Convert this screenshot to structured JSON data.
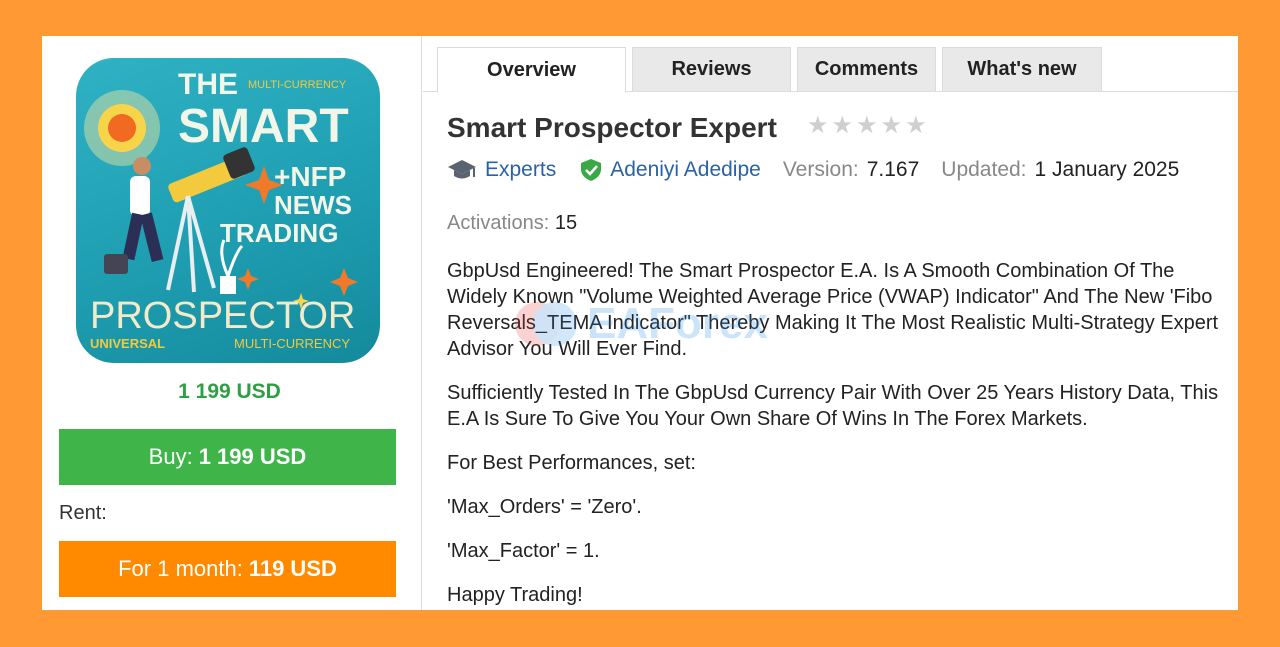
{
  "product": {
    "image_text": {
      "line1": "THE",
      "line1b": "MULTI-CURRENCY",
      "line2": "SMART",
      "line3": "+NFP",
      "line4": "NEWS",
      "line5": "TRADING",
      "line6": "PROSPECTOR",
      "line7a": "UNIVERSAL",
      "line7b": "MULTI-CURRENCY"
    },
    "price": "1 199 USD",
    "buy_label": "Buy:",
    "buy_price": "1 199 USD",
    "rent_label": "Rent:",
    "rent_period": "For 1 month:",
    "rent_price": "119 USD"
  },
  "tabs": [
    {
      "label": "Overview",
      "active": true
    },
    {
      "label": "Reviews"
    },
    {
      "label": "Comments"
    },
    {
      "label": "What's new"
    }
  ],
  "title": "Smart Prospector Expert",
  "rating": 0,
  "meta": {
    "category": "Experts",
    "author": "Adeniyi Adedipe",
    "version_label": "Version:",
    "version": "7.167",
    "updated_label": "Updated:",
    "updated": "1 January 2025"
  },
  "activations": {
    "label": "Activations:",
    "value": "15"
  },
  "description": [
    "GbpUsd Engineered! The Smart Prospector E.A. Is A Smooth Combination Of  The Widely Known \"Volume Weighted Average Price (VWAP) Indicator\" And The New 'Fibo Reversals_TEMA Indicator\" Thereby Making It The Most Realistic Multi-Strategy Expert Advisor You Will Ever Find.",
    "Sufficiently Tested In The GbpUsd Currency Pair With Over 25 Years History Data, This E.A Is Sure To Give You Your Own Share Of Wins In The Forex Markets.",
    "For Best Performances, set:",
    "'Max_Orders' = 'Zero'.",
    "'Max_Factor' = 1.",
    "Happy Trading!"
  ],
  "watermark": "EAForex",
  "colors": {
    "frame": "#FF9933",
    "buy": "#3fb549",
    "rent": "#ff8a00",
    "price": "#2ea043",
    "link": "#2a62a6"
  }
}
